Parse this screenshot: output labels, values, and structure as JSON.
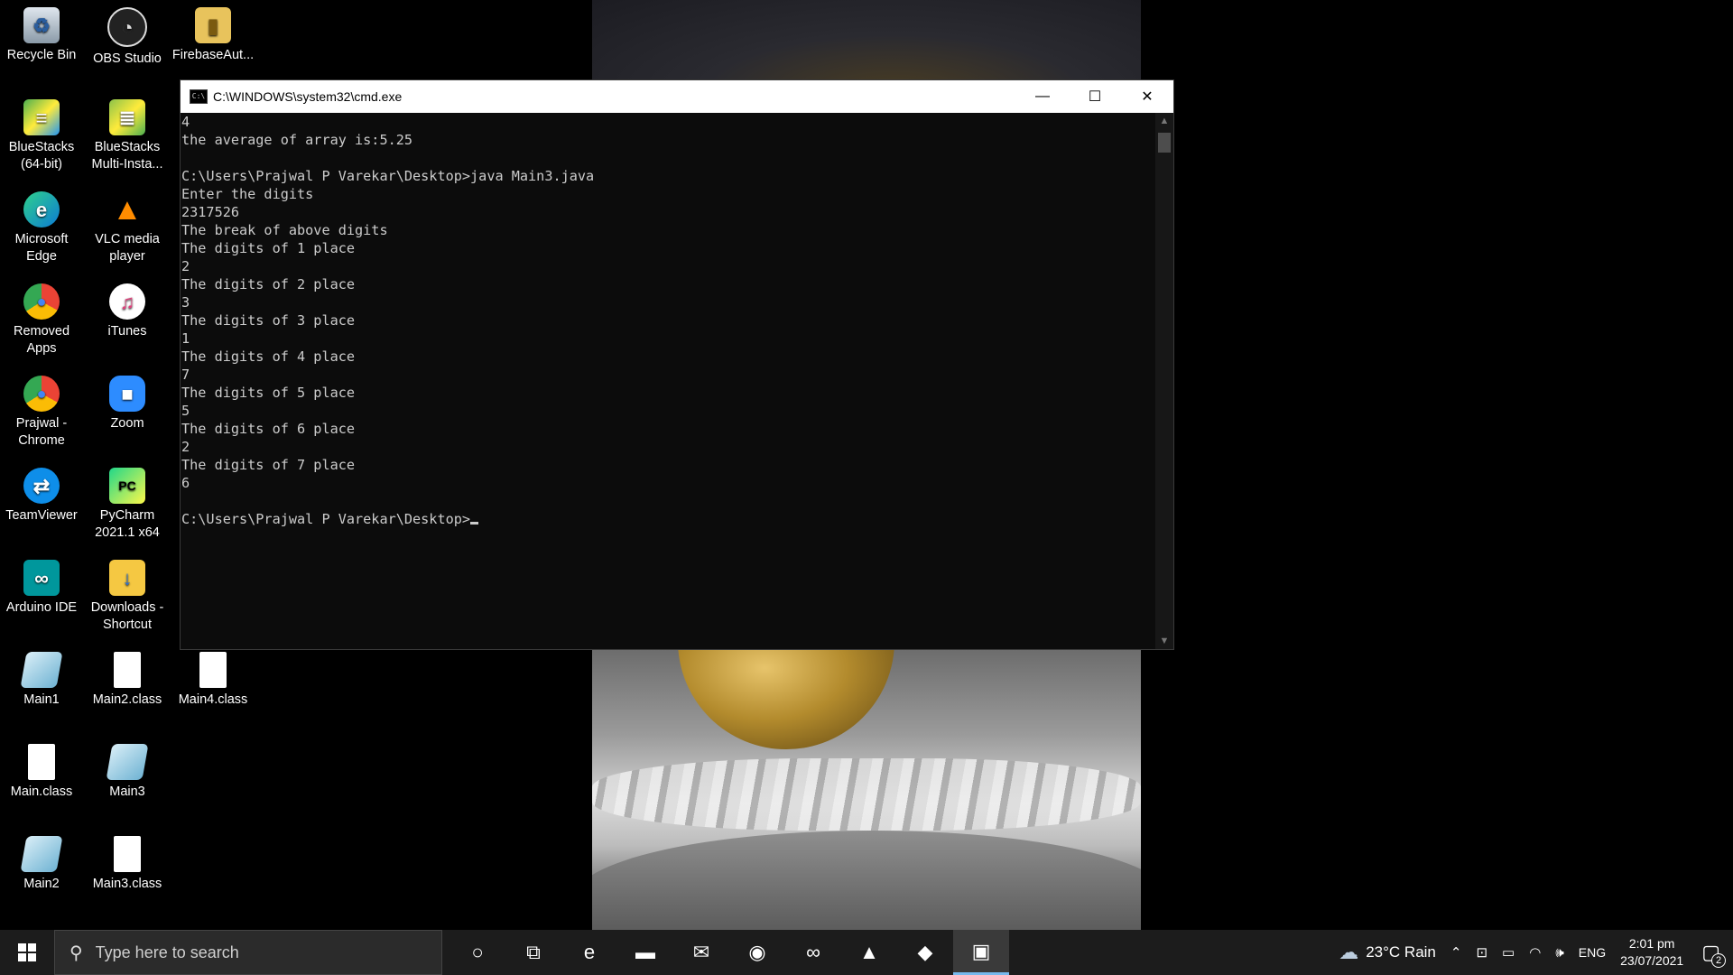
{
  "desktop": {
    "icons": [
      {
        "label": "Recycle Bin",
        "icon": "recycle-bin-icon"
      },
      {
        "label": "OBS Studio",
        "icon": "obs-icon"
      },
      {
        "label": "FirebaseAut...",
        "icon": "zip-folder-icon"
      },
      {
        "label": "BlueStacks (64-bit)",
        "icon": "bluestacks-icon"
      },
      {
        "label": "BlueStacks Multi-Insta...",
        "icon": "bluestacks-multi-icon"
      },
      {
        "label": "Microsoft Edge",
        "icon": "edge-icon"
      },
      {
        "label": "VLC media player",
        "icon": "vlc-icon"
      },
      {
        "label": "Removed Apps",
        "icon": "chrome-icon"
      },
      {
        "label": "iTunes",
        "icon": "itunes-icon"
      },
      {
        "label": "Prajwal - Chrome",
        "icon": "chrome-profile-icon"
      },
      {
        "label": "Zoom",
        "icon": "zoom-icon"
      },
      {
        "label": "TeamViewer",
        "icon": "teamviewer-icon"
      },
      {
        "label": "PyCharm 2021.1 x64",
        "icon": "pycharm-icon"
      },
      {
        "label": "Arduino IDE",
        "icon": "arduino-icon"
      },
      {
        "label": "Downloads - Shortcut",
        "icon": "downloads-shortcut-icon"
      },
      {
        "label": "Main1",
        "icon": "java-file-icon"
      },
      {
        "label": "Main2.class",
        "icon": "file-icon"
      },
      {
        "label": "Main4.class",
        "icon": "file-icon"
      },
      {
        "label": "Main.class",
        "icon": "file-icon"
      },
      {
        "label": "Main3",
        "icon": "java-file-icon"
      },
      {
        "label": "Main2",
        "icon": "java-file-icon"
      },
      {
        "label": "Main3.class",
        "icon": "file-icon"
      }
    ]
  },
  "window": {
    "title": "C:\\WINDOWS\\system32\\cmd.exe",
    "app_icon_text": "C:\\",
    "minimize_glyph": "—",
    "maximize_glyph": "☐",
    "close_glyph": "✕"
  },
  "console": {
    "lines": [
      "4",
      "the average of array is:5.25",
      "",
      "C:\\Users\\Prajwal P Varekar\\Desktop>java Main3.java",
      "Enter the digits",
      "2317526",
      "The break of above digits",
      "The digits of 1 place",
      "2",
      "The digits of 2 place",
      "3",
      "The digits of 3 place",
      "1",
      "The digits of 4 place",
      "7",
      "The digits of 5 place",
      "5",
      "The digits of 6 place",
      "2",
      "The digits of 7 place",
      "6",
      "",
      "C:\\Users\\Prajwal P Varekar\\Desktop>"
    ]
  },
  "taskbar": {
    "search_placeholder": "Type here to search",
    "apps": [
      {
        "name": "cortana-icon",
        "glyph": "○"
      },
      {
        "name": "task-view-icon",
        "glyph": "⧉"
      },
      {
        "name": "edge-taskbar-icon",
        "glyph": "e"
      },
      {
        "name": "file-explorer-icon",
        "glyph": "▬"
      },
      {
        "name": "mail-icon",
        "glyph": "✉"
      },
      {
        "name": "chrome-taskbar-icon",
        "glyph": "◉"
      },
      {
        "name": "arduino-taskbar-icon",
        "glyph": "∞"
      },
      {
        "name": "photos-icon",
        "glyph": "▲"
      },
      {
        "name": "notepad-icon",
        "glyph": "◆"
      },
      {
        "name": "cmd-taskbar-icon",
        "glyph": "▣"
      }
    ],
    "weather": "23°C  Rain",
    "language": "ENG",
    "time": "2:01 pm",
    "date": "23/07/2021",
    "notification_count": "2"
  },
  "colors": {
    "console_bg": "#0c0c0c",
    "console_fg": "#cccccc",
    "taskbar_bg": "#1c1c1c"
  }
}
